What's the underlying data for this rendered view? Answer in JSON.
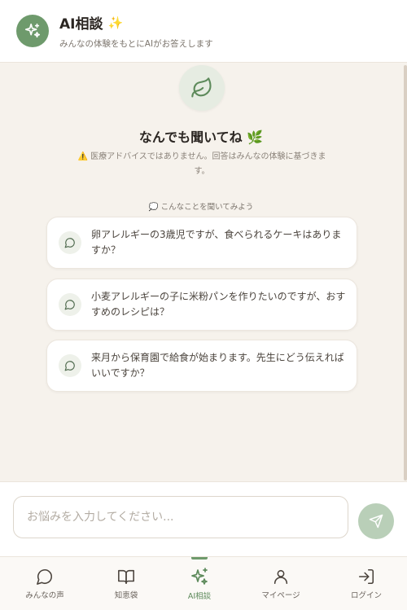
{
  "header": {
    "title": "AI相談",
    "title_emoji": "✨",
    "subtitle": "みんなの体験をもとにAIがお答えします",
    "avatar_icon": "sparkles-icon"
  },
  "welcome": {
    "icon": "leaf-icon",
    "title": "なんでも聞いてね 🌿",
    "disclaimer_icon": "⚠️",
    "disclaimer": "医療アドバイスではありません。回答はみんなの体験に基づきます。"
  },
  "suggestions": {
    "label_icon": "💭",
    "label": "こんなことを聞いてみよう",
    "items": [
      {
        "text": "卵アレルギーの3歳児ですが、食べられるケーキはありますか？"
      },
      {
        "text": "小麦アレルギーの子に米粉パンを作りたいのですが、おすすめのレシピは？"
      },
      {
        "text": "来月から保育園で給食が始まります。先生にどう伝えればいいですか？"
      }
    ]
  },
  "composer": {
    "placeholder": "お悩みを入力してください...",
    "value": "",
    "send_icon": "send-icon"
  },
  "nav": {
    "items": [
      {
        "label": "みんなの声",
        "icon": "chat-bubble-icon",
        "active": false
      },
      {
        "label": "知恵袋",
        "icon": "book-icon",
        "active": false
      },
      {
        "label": "AI相談",
        "icon": "sparkles-icon",
        "active": true
      },
      {
        "label": "マイページ",
        "icon": "user-icon",
        "active": false
      },
      {
        "label": "ログイン",
        "icon": "login-icon",
        "active": false
      }
    ]
  },
  "colors": {
    "accent": "#6e9a6c",
    "background": "#f6f2ec",
    "send_button": "#b9cfb8"
  }
}
